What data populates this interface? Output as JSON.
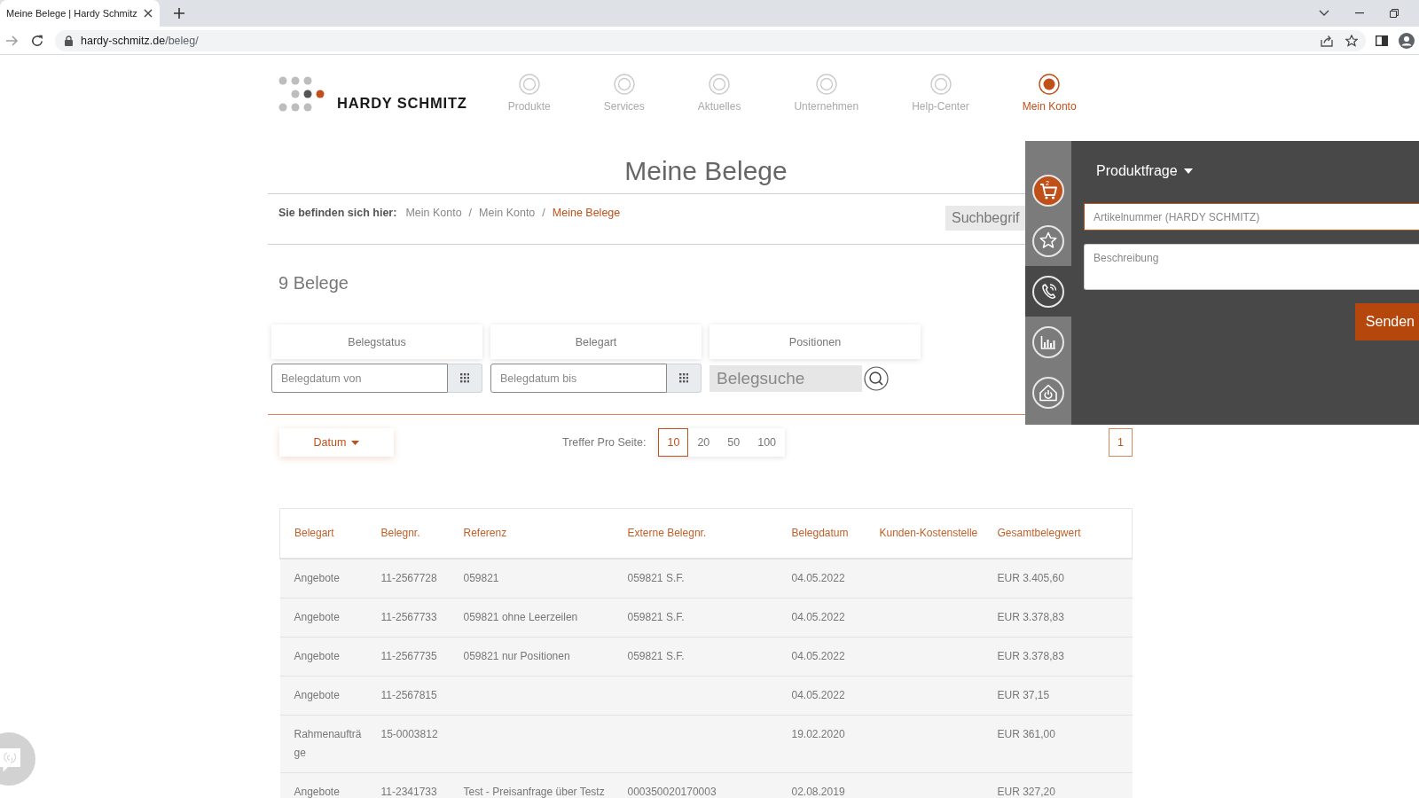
{
  "browser": {
    "tab_title": "Meine Belege | Hardy Schmitz",
    "address": {
      "domain": "hardy-schmitz.de",
      "path": "/beleg/"
    }
  },
  "header": {
    "logo": "HARDY SCHMITZ",
    "nav": [
      {
        "label": "Produkte",
        "selected": false
      },
      {
        "label": "Services",
        "selected": false
      },
      {
        "label": "Aktuelles",
        "selected": false
      },
      {
        "label": "Unternehmen",
        "selected": false
      },
      {
        "label": "Help-Center",
        "selected": false
      },
      {
        "label": "Mein Konto",
        "selected": true
      }
    ]
  },
  "page_title": "Meine Belege",
  "breadcrumb": {
    "label": "Sie befinden sich hier:",
    "items": [
      {
        "label": "Mein Konto",
        "selected": false
      },
      {
        "label": "Mein Konto",
        "selected": false
      },
      {
        "label": "Meine Belege",
        "selected": true
      }
    ],
    "separators": [
      "/",
      "/"
    ]
  },
  "search": {
    "placeholder": "Suchbegrif"
  },
  "result_count": "9 Belege",
  "filters": {
    "tabs": [
      {
        "label": "Belegstatus"
      },
      {
        "label": "Belegart"
      },
      {
        "label": "Positionen"
      }
    ],
    "date_from": {
      "placeholder": "Belegdatum von"
    },
    "date_to": {
      "placeholder": "Belegdatum bis"
    },
    "document_search": {
      "placeholder": "Belegsuche"
    }
  },
  "sort": {
    "label": "Datum"
  },
  "page_size": {
    "label": "Treffer Pro Seite:",
    "options": [
      {
        "label": "10",
        "selected": true
      },
      {
        "label": "20",
        "selected": false
      },
      {
        "label": "50",
        "selected": false
      },
      {
        "label": "100",
        "selected": false
      }
    ]
  },
  "pagination": [
    {
      "label": "1",
      "selected": true
    }
  ],
  "table": {
    "columns": [
      "Belegart",
      "Belegnr.",
      "Referenz",
      "Externe Belegnr.",
      "Belegdatum",
      "Kunden-Kostenstelle",
      "Gesamtbelegwert"
    ],
    "rows": [
      {
        "type": "Angebote",
        "number": "11-2567728",
        "reference": "059821",
        "external_number": "059821 S.F.",
        "date": "04.05.2022",
        "total": "EUR 3.405,60"
      },
      {
        "type": "Angebote",
        "number": "11-2567733",
        "reference": "059821 ohne Leerzeilen",
        "external_number": "059821 S.F.",
        "date": "04.05.2022",
        "total": "EUR 3.378,83"
      },
      {
        "type": "Angebote",
        "number": "11-2567735",
        "reference": "059821 nur Positionen",
        "external_number": "059821 S.F.",
        "date": "04.05.2022",
        "total": "EUR 3.378,83"
      },
      {
        "type": "Angebote",
        "number": "11-2567815",
        "date": "04.05.2022",
        "total": "EUR 37,15"
      },
      {
        "type": "Rahmenaufträge",
        "number": "15-0003812",
        "date": "19.02.2020",
        "total": "EUR 361,00"
      },
      {
        "type": "Angebote",
        "number": "11-2341733",
        "reference": "Test - Preisanfrage über Testz",
        "external_number": "000350020170003",
        "date": "02.08.2019",
        "total": "EUR 327,20"
      }
    ]
  },
  "side_panel": {
    "tabs": [
      {
        "kind": "cart",
        "count": "2",
        "selected": false
      },
      {
        "kind": "star",
        "selected": false
      },
      {
        "kind": "phone",
        "selected": true
      },
      {
        "kind": "chart",
        "selected": false
      },
      {
        "kind": "house",
        "selected": false
      }
    ],
    "form": {
      "topic": "Produktfrage",
      "article_number": {
        "placeholder": "Artikelnummer (HARDY SCHMITZ)",
        "focused": true
      },
      "description": {
        "placeholder": "Beschreibung"
      },
      "submit": "Senden"
    }
  }
}
